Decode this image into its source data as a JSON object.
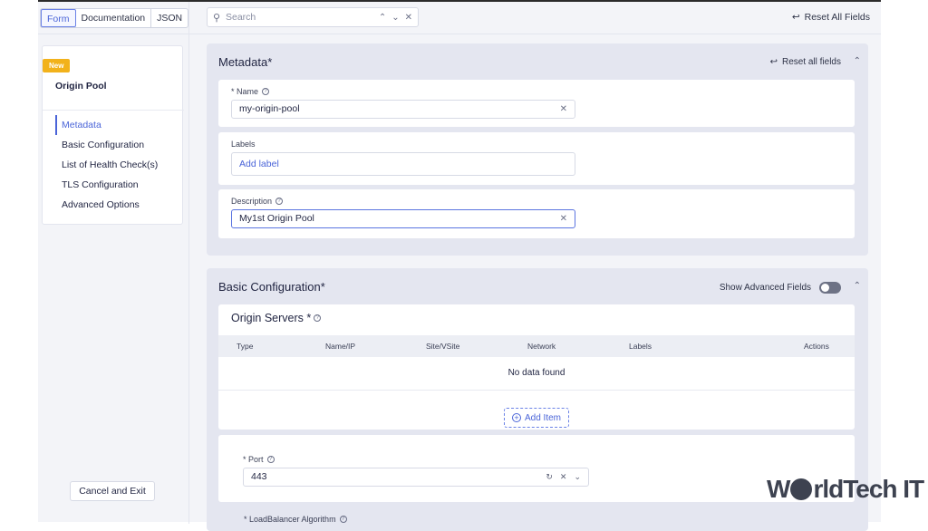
{
  "tabs": [
    {
      "label": "Form",
      "active": true
    },
    {
      "label": "Documentation",
      "active": false
    },
    {
      "label": "JSON",
      "active": false
    }
  ],
  "search": {
    "placeholder": "Search"
  },
  "top": {
    "reset_all_label": "Reset All Fields"
  },
  "sidebar": {
    "badge": "New",
    "title": "Origin Pool",
    "items": [
      {
        "label": "Metadata",
        "active": true
      },
      {
        "label": "Basic Configuration"
      },
      {
        "label": "List of Health Check(s)"
      },
      {
        "label": "TLS Configuration"
      },
      {
        "label": "Advanced Options"
      }
    ],
    "cancel_label": "Cancel and Exit"
  },
  "metadata": {
    "title": "Metadata*",
    "reset_label": "Reset all fields",
    "name_label": "* Name",
    "name_value": "my-origin-pool",
    "labels_label": "Labels",
    "labels_placeholder": "Add label",
    "description_label": "Description",
    "description_value": "My1st Origin Pool"
  },
  "basic": {
    "title": "Basic Configuration*",
    "advanced_label": "Show Advanced Fields",
    "servers_title": "Origin Servers *",
    "columns": [
      "Type",
      "Name/IP",
      "Site/VSite",
      "Network",
      "Labels",
      "Actions"
    ],
    "empty_text": "No data found",
    "add_item_label": "Add Item",
    "port_label": "* Port",
    "port_value": "443",
    "lb_label": "* LoadBalancer Algorithm"
  },
  "watermark": {
    "text_left": "W",
    "text_right": "rldTech IT"
  },
  "colors": {
    "accent": "#4a64d8",
    "badge": "#f2b21b",
    "section_bg": "#e4e6f0"
  }
}
